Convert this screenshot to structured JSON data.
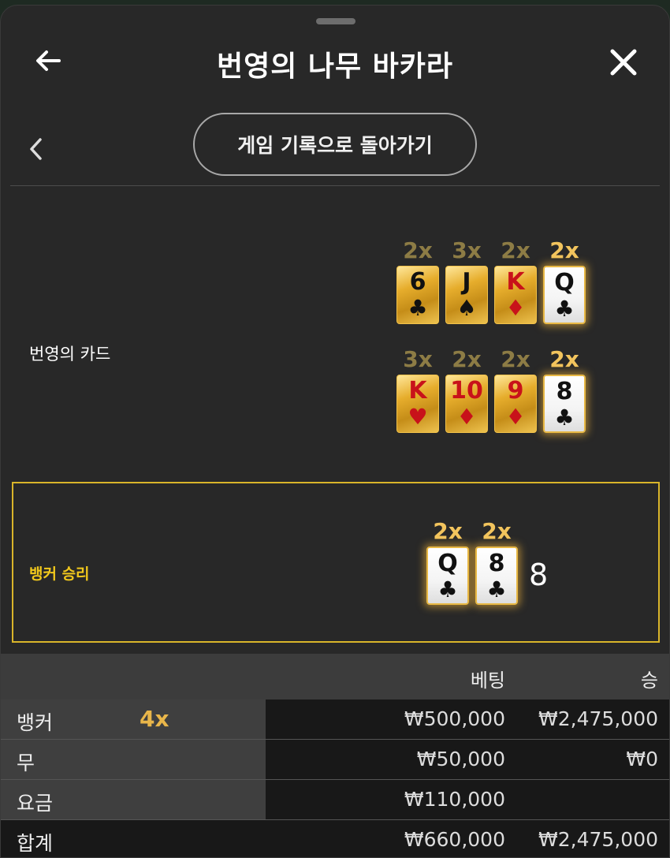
{
  "header": {
    "title": "번영의 나무 바카라"
  },
  "nav": {
    "back_to_history": "게임 기록으로 돌아가기"
  },
  "prosperity": {
    "label": "번영의 카드",
    "row1": [
      {
        "mult": "2x",
        "rank": "6",
        "suit": "♣",
        "color": "black",
        "style": "gold",
        "glow": "dim"
      },
      {
        "mult": "3x",
        "rank": "J",
        "suit": "♠",
        "color": "black",
        "style": "gold",
        "glow": "dim"
      },
      {
        "mult": "2x",
        "rank": "K",
        "suit": "♦",
        "color": "red",
        "style": "gold",
        "glow": "dim"
      },
      {
        "mult": "2x",
        "rank": "Q",
        "suit": "♣",
        "color": "black",
        "style": "white",
        "glow": "bright"
      }
    ],
    "row2": [
      {
        "mult": "3x",
        "rank": "K",
        "suit": "♥",
        "color": "red",
        "style": "gold",
        "glow": "dim"
      },
      {
        "mult": "2x",
        "rank": "10",
        "suit": "♦",
        "color": "red",
        "style": "gold",
        "glow": "dim"
      },
      {
        "mult": "2x",
        "rank": "9",
        "suit": "♦",
        "color": "red",
        "style": "gold",
        "glow": "dim"
      },
      {
        "mult": "2x",
        "rank": "8",
        "suit": "♣",
        "color": "black",
        "style": "white",
        "glow": "bright"
      }
    ]
  },
  "result": {
    "label": "뱅커 승리",
    "cards": [
      {
        "mult": "2x",
        "rank": "Q",
        "suit": "♣",
        "color": "black"
      },
      {
        "mult": "2x",
        "rank": "8",
        "suit": "♣",
        "color": "black"
      }
    ],
    "score": "8"
  },
  "table": {
    "header_bet": "베팅",
    "header_win": "승",
    "rows": [
      {
        "label": "뱅커",
        "mult": "4x",
        "bet": "₩500,000",
        "win": "₩2,475,000"
      },
      {
        "label": "무",
        "mult": "",
        "bet": "₩50,000",
        "win": "₩0"
      },
      {
        "label": "요금",
        "mult": "",
        "bet": "₩110,000",
        "win": ""
      }
    ],
    "total": {
      "label": "합계",
      "bet": "₩660,000",
      "win": "₩2,475,000"
    }
  },
  "colors": {
    "accent_gold": "#f2c45d",
    "win_label": "#f1c81c",
    "box_border": "#d9b52a"
  }
}
